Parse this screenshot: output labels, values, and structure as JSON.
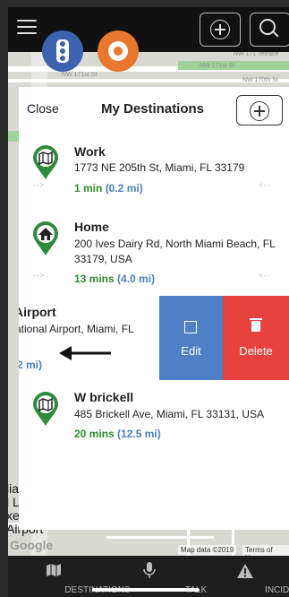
{
  "map": {
    "streets": [
      "NW 171 Terrace",
      "NW 171st St",
      "NW 171st St",
      "NW 170th St"
    ],
    "place_label_lines": [
      "lia",
      "l L",
      "xecutive",
      "Airport"
    ],
    "logo": "Google",
    "attribution": "Map data ©2019",
    "terms": "Terms of Use"
  },
  "modal": {
    "close_label": "Close",
    "title": "My Destinations"
  },
  "destinations": [
    {
      "name": "Work",
      "address": "1773 NE 205th St, Miami, FL 33179",
      "eta_time": "1 min",
      "eta_distance": "(0.2 mi)",
      "icon": "map-pin-icon",
      "arrow_left": "-->",
      "arrow_right": "<--"
    },
    {
      "name": "Home",
      "address": "200 Ives Dairy Rd, North Miami Beach, FL 33179, USA",
      "eta_time": "13 mins",
      "eta_distance": "(4.0 mi)",
      "icon": "home-pin-icon",
      "arrow_left": "-->",
      "arrow_right": "<--"
    },
    {
      "name": "Airport",
      "address": "ational Airport, Miami, FL",
      "eta_distance_partial": "2 mi)",
      "name_partial": "Airport"
    },
    {
      "name": "W brickell",
      "address": "485 Brickell Ave, Miami, FL 33131, USA",
      "eta_time": "20 mins",
      "eta_distance": "(12.5 mi)",
      "icon": "map-pin-icon"
    }
  ],
  "swipe_actions": {
    "edit_label": "Edit",
    "delete_label": "Delete"
  },
  "tabs": [
    {
      "label": "DESTINATIONS",
      "icon": "map-icon"
    },
    {
      "label": "TALK",
      "icon": "microphone-icon"
    },
    {
      "label": "INCIDENTS",
      "icon": "warning-icon"
    }
  ],
  "colors": {
    "eta_time": "#2e8b2e",
    "eta_distance": "#4a7fc1",
    "pin": "#2e8b3a",
    "edit": "#4f80c7",
    "delete": "#e8423f",
    "traffic_bubble": "#3d63b0",
    "camera_bubble": "#e9772d"
  }
}
